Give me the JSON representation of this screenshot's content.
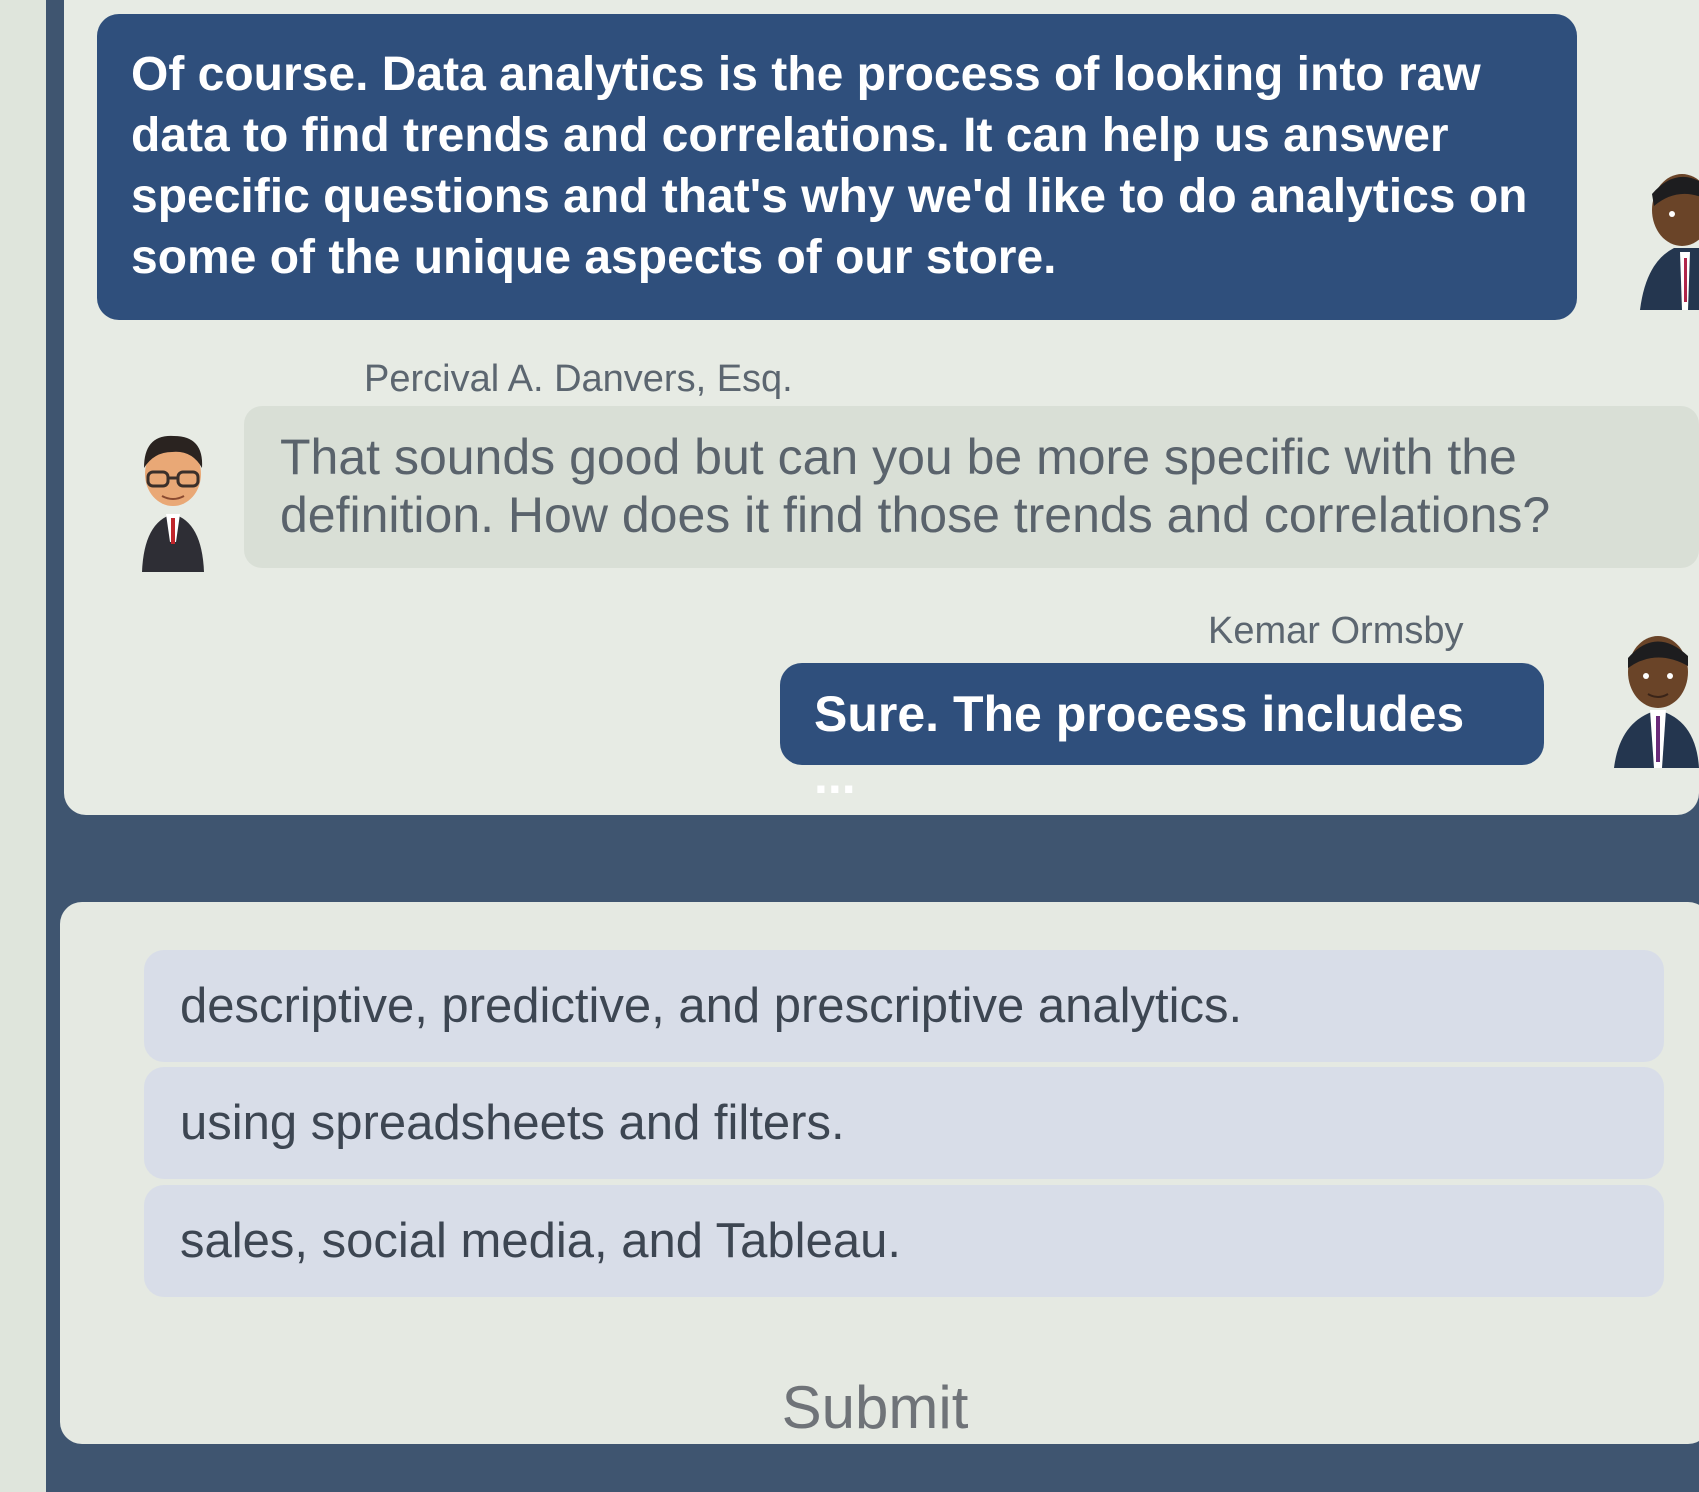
{
  "conversation": {
    "messages": [
      {
        "speaker": "",
        "text": "Of course. Data analytics is the process of looking into raw data to find trends and correlations. It can help us answer specific questions and that's why we'd like to do analytics on some of the unique aspects of our store."
      },
      {
        "speaker": "Percival A. Danvers, Esq.",
        "text": "That sounds good but can you be more specific with the definition. How does it find those trends and correlations?"
      },
      {
        "speaker": "Kemar Ormsby",
        "text": "Sure. The process includes ..."
      }
    ]
  },
  "quiz": {
    "options": [
      "descriptive, predictive, and prescriptive analytics.",
      "using spreadsheets and filters.",
      "sales, social media, and Tableau."
    ],
    "submit_label": "Submit"
  },
  "colors": {
    "page_background": "#3f5570",
    "panel": "#e7ebe4",
    "dark_bubble": "#2f4f7c",
    "light_bubble": "#d9dfd6",
    "option_background": "#d8dde8"
  }
}
